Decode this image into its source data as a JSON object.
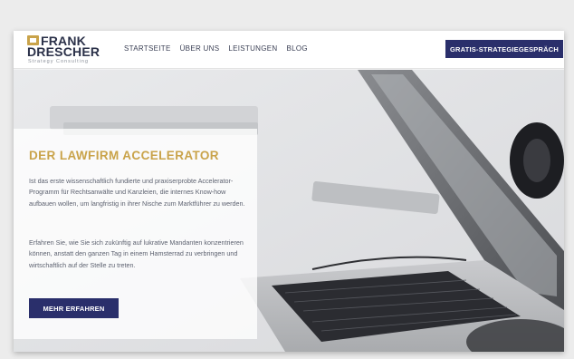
{
  "logo": {
    "line1": "FRANK",
    "line2": "DRESCHER",
    "tagline": "Strategy Consulting"
  },
  "nav": {
    "items": [
      "STARTSEITE",
      "ÜBER UNS",
      "LEISTUNGEN",
      "BLOG"
    ]
  },
  "header": {
    "cta_label": "GRATIS-STRATEGIEGESPRÄCH"
  },
  "hero": {
    "title": "DER LAWFIRM ACCELERATOR",
    "paragraph1": "Ist das erste wissenschaftlich fundierte und praxiserprobte Accelerator-Programm für Rechtsanwälte und Kanzleien, die internes Know-how aufbauen wollen, um langfristig in ihrer Nische zum Marktführer zu werden.",
    "paragraph2": "Erfahren Sie, wie Sie sich zukünftig auf lukrative Mandanten konzentrieren können, anstatt den ganzen Tag in einem Hamsterrad zu verbringen und wirtschaftlich auf der Stelle zu treten.",
    "button_label": "MEHR ERFAHREN"
  },
  "colors": {
    "brand_navy": "#2a2f6b",
    "accent_gold": "#c9a34a",
    "text_gray": "#5d6270"
  }
}
